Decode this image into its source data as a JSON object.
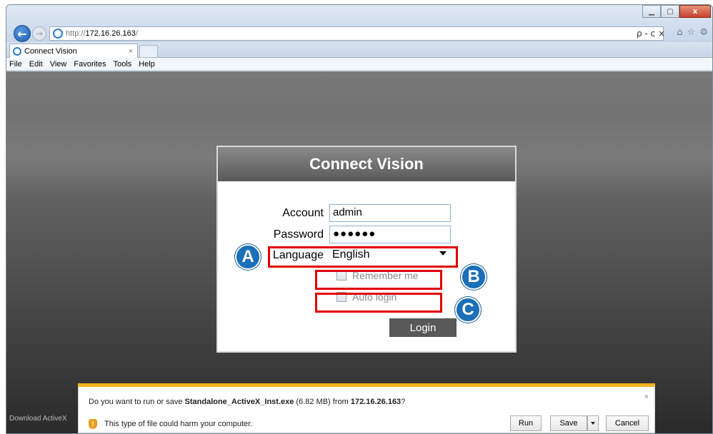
{
  "browser": {
    "url": {
      "protocol": "http://",
      "host": "172.16.26.163",
      "path": "/"
    },
    "url_tools": "ρ - c ×",
    "right_icons": [
      "home-icon",
      "star-icon",
      "gear-icon"
    ],
    "tab": {
      "title": "Connect Vision",
      "close": "×"
    },
    "menu": [
      "File",
      "Edit",
      "View",
      "Favorites",
      "Tools",
      "Help"
    ],
    "window_controls": {
      "minimize": "▁",
      "maximize": "▢",
      "close": "x"
    }
  },
  "login": {
    "title": "Connect Vision",
    "account_label": "Account",
    "account_value": "admin",
    "password_label": "Password",
    "password_value": "●●●●●●",
    "language_label": "Language",
    "language_value": "English",
    "remember_label": "Remember me",
    "auto_login_label": "Auto login",
    "login_button": "Login"
  },
  "annotations": {
    "a": "A",
    "b": "B",
    "c": "C",
    "color": "#e00000",
    "callout_color": "#1b6fb8"
  },
  "download_bar": {
    "question_prefix": "Do you want to run or save ",
    "file_name": "Standalone_ActiveX_Inst.exe",
    "size_text": " (6.82 MB) from ",
    "source_host": "172.16.26.163",
    "question_suffix": "?",
    "warning": "This type of file could harm your computer.",
    "run": "Run",
    "save": "Save",
    "cancel": "Cancel",
    "close": "×"
  },
  "status_text": "Download ActiveX"
}
